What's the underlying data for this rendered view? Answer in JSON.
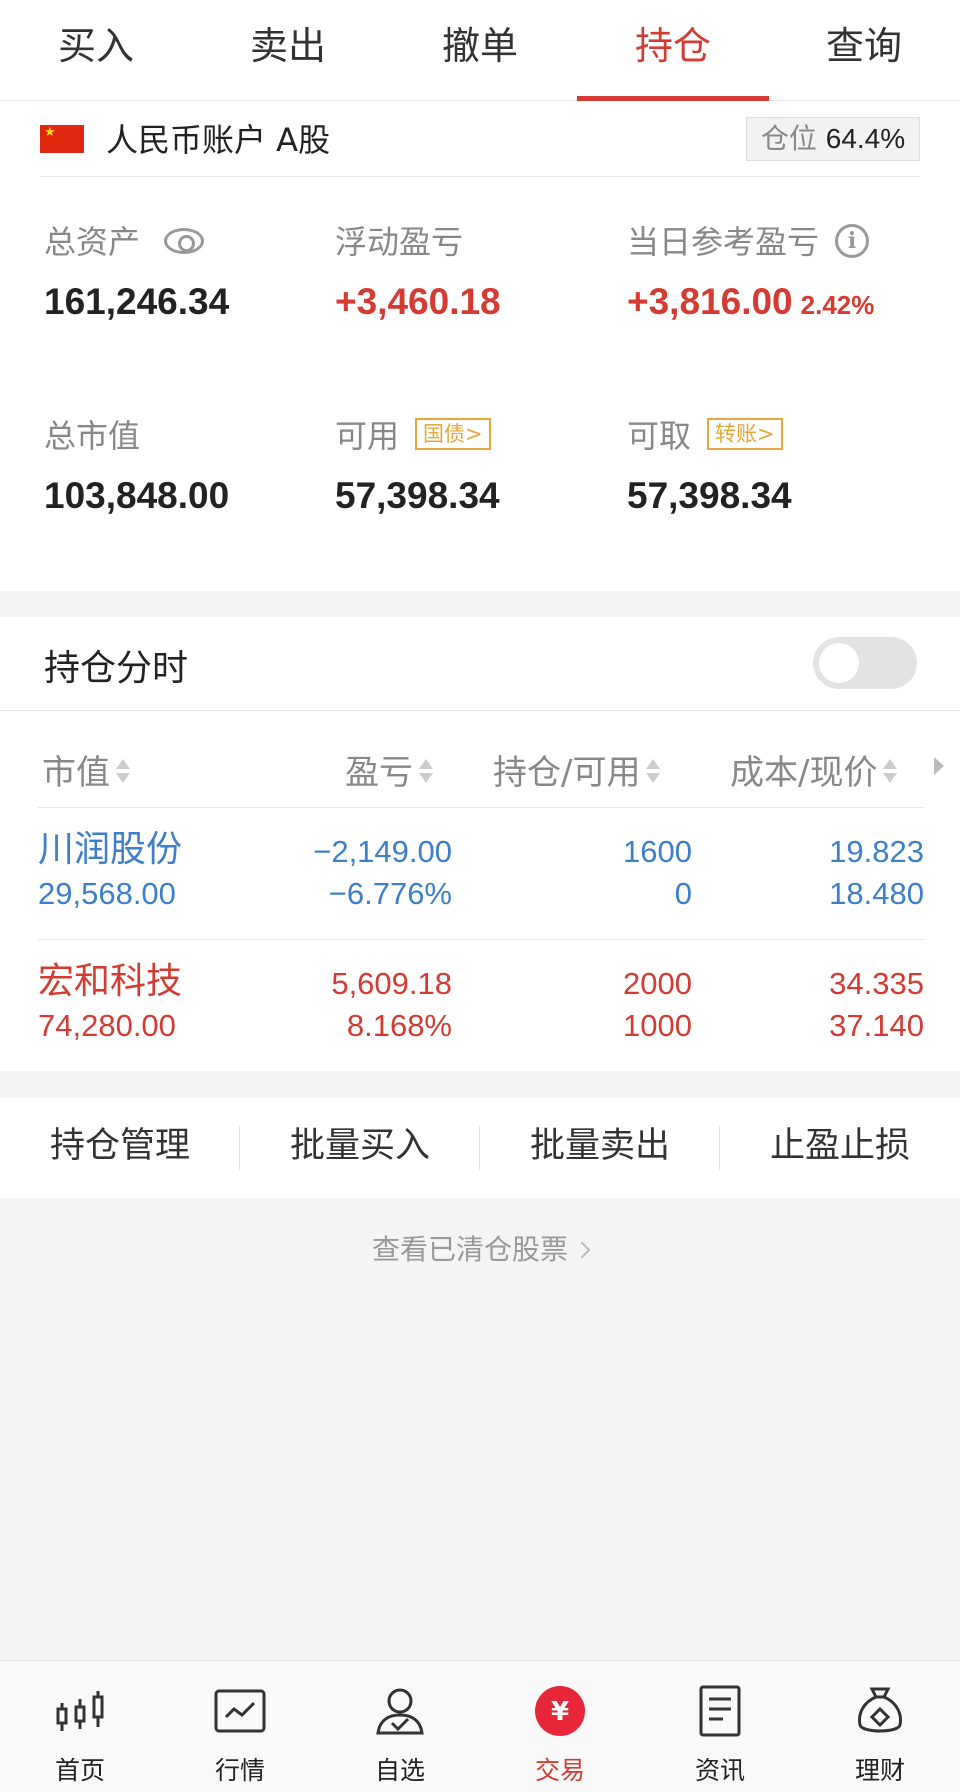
{
  "tabs": [
    "买入",
    "卖出",
    "撤单",
    "持仓",
    "查询"
  ],
  "account": {
    "name": "人民币账户 A股",
    "position_label": "仓位",
    "position_value": "64.4%"
  },
  "stats": {
    "total_assets_label": "总资产",
    "total_assets": "161,246.34",
    "floating_pl_label": "浮动盈亏",
    "floating_pl": "+3,460.18",
    "daily_pl_label": "当日参考盈亏",
    "daily_pl": "+3,816.00",
    "daily_pl_pct": "2.42%",
    "market_value_label": "总市值",
    "market_value": "103,848.00",
    "available_label": "可用",
    "available_tag": "国债>",
    "available": "57,398.34",
    "withdrawable_label": "可取",
    "withdrawable_tag": "转账>",
    "withdrawable": "57,398.34"
  },
  "holdings": {
    "title": "持仓分时",
    "columns": [
      "市值",
      "盈亏",
      "持仓/可用",
      "成本/现价"
    ],
    "rows": [
      {
        "name": "川润股份",
        "market_value": "29,568.00",
        "pl": "−2,149.00",
        "pl_pct": "−6.776%",
        "holding": "1600",
        "available": "0",
        "cost": "19.823",
        "price": "18.480",
        "color": "#3d7fc8"
      },
      {
        "name": "宏和科技",
        "market_value": "74,280.00",
        "pl": "5,609.18",
        "pl_pct": "8.168%",
        "holding": "2000",
        "available": "1000",
        "cost": "34.335",
        "price": "37.140",
        "color": "#d43c33"
      }
    ]
  },
  "actions": [
    "持仓管理",
    "批量买入",
    "批量卖出",
    "止盈止损"
  ],
  "cleared_link": "查看已清仓股票",
  "bottom_nav": [
    "首页",
    "行情",
    "自选",
    "交易",
    "资讯",
    "理财"
  ],
  "colors": {
    "accent": "#d43c33",
    "down": "#3d7fc8",
    "tag": "#e7a73a"
  }
}
